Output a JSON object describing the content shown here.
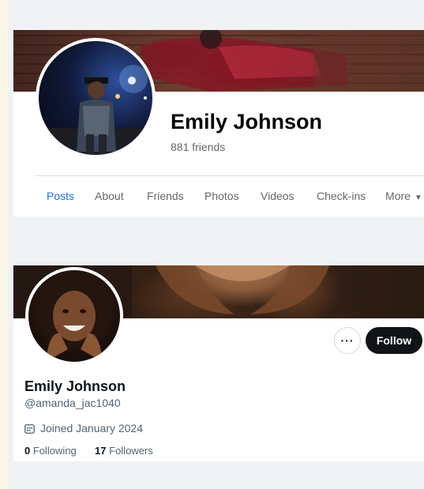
{
  "facebook_profile": {
    "name": "Emily Johnson",
    "friends": "881 friends",
    "tabs": [
      {
        "label": "Posts",
        "active": true
      },
      {
        "label": "About"
      },
      {
        "label": "Friends"
      },
      {
        "label": "Photos"
      },
      {
        "label": "Videos"
      },
      {
        "label": "Check-ins"
      },
      {
        "label": "More",
        "icon": "caret-down-icon"
      }
    ],
    "colors": {
      "active_tab": "#1b74e4",
      "muted_text": "#65676b"
    }
  },
  "x_profile": {
    "more_button_label": "···",
    "follow_button_label": "Follow",
    "name": "Emily Johnson",
    "handle": "@amanda_jac1040",
    "joined": "Joined January 2024",
    "joined_icon": "calendar-icon",
    "following_count": "0",
    "following_label": "Following",
    "followers_count": "17",
    "followers_label": "Followers",
    "colors": {
      "follow_button_bg": "#0f1419",
      "muted_text": "#536471"
    }
  }
}
